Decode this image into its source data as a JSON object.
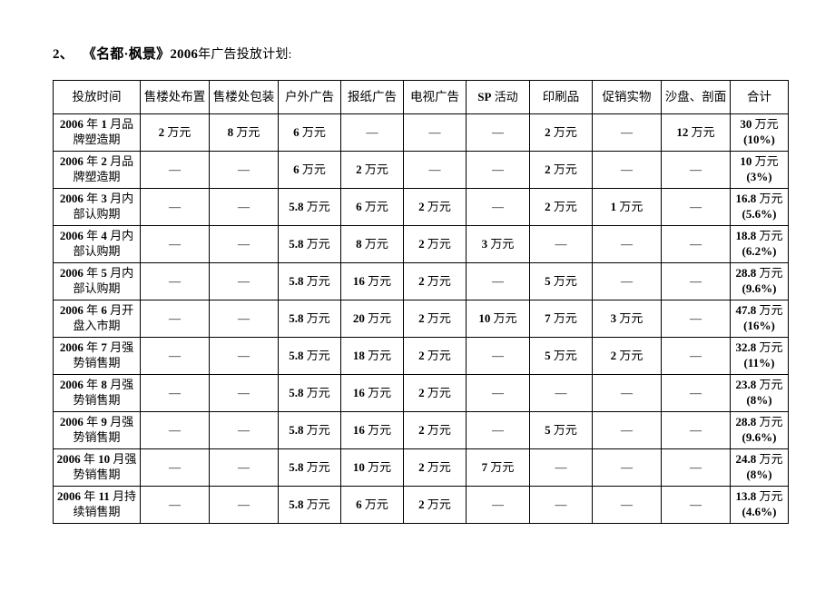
{
  "document": {
    "title_number": "2、",
    "title_main": "《名都·枫景》",
    "title_year": "2006",
    "title_tail": "年广告投放计划:"
  },
  "table": {
    "headers": [
      "投放时间",
      "售楼处布置",
      "售楼处包装",
      "户外广告",
      "报纸广告",
      "电视广告",
      "SP 活动",
      "印刷品",
      "促销实物",
      "沙盘、剖面",
      "合计"
    ],
    "sp_header": {
      "latin": "SP",
      "cjk": "活动"
    },
    "dash": "—",
    "rows": [
      {
        "period": "2006年1月品牌塑造期",
        "period_line1": "2006 年 1 月品",
        "period_line2": "牌塑造期",
        "cells": [
          "2 万元",
          "8 万元",
          "6 万元",
          "—",
          "—",
          "—",
          "2 万元",
          "—",
          "12 万元"
        ],
        "total": "30 万元",
        "percent": "(10%)"
      },
      {
        "period": "2006年2月品牌塑造期",
        "period_line1": "2006 年 2 月品",
        "period_line2": "牌塑造期",
        "cells": [
          "—",
          "—",
          "6 万元",
          "2 万元",
          "—",
          "—",
          "2 万元",
          "—",
          "—"
        ],
        "total": "10 万元",
        "percent": "(3%)"
      },
      {
        "period": "2006年3月内部认购期",
        "period_line1": "2006 年 3 月内",
        "period_line2": "部认购期",
        "cells": [
          "—",
          "—",
          "5.8 万元",
          "6 万元",
          "2 万元",
          "—",
          "2 万元",
          "1 万元",
          "—"
        ],
        "total": "16.8 万元",
        "percent": "(5.6%)"
      },
      {
        "period": "2006年4月内部认购期",
        "period_line1": "2006 年 4 月内",
        "period_line2": "部认购期",
        "cells": [
          "—",
          "—",
          "5.8 万元",
          "8 万元",
          "2 万元",
          "3 万元",
          "—",
          "—",
          "—"
        ],
        "total": "18.8 万元",
        "percent": "(6.2%)"
      },
      {
        "period": "2006年5月内部认购期",
        "period_line1": "2006 年 5 月内",
        "period_line2": "部认购期",
        "cells": [
          "—",
          "—",
          "5.8 万元",
          "16 万元",
          "2 万元",
          "—",
          "5 万元",
          "—",
          "—"
        ],
        "total": "28.8 万元",
        "percent": "(9.6%)"
      },
      {
        "period": "2006年6月开盘入市期",
        "period_line1": "2006 年 6 月开",
        "period_line2": "盘入市期",
        "cells": [
          "—",
          "—",
          "5.8 万元",
          "20 万元",
          "2 万元",
          "10 万元",
          "7 万元",
          "3 万元",
          "—"
        ],
        "total": "47.8 万元",
        "percent": "(16%)"
      },
      {
        "period": "2006年7月强势销售期",
        "period_line1": "2006 年 7 月强",
        "period_line2": "势销售期",
        "cells": [
          "—",
          "—",
          "5.8 万元",
          "18 万元",
          "2 万元",
          "—",
          "5 万元",
          "2 万元",
          "—"
        ],
        "total": "32.8 万元",
        "percent": "(11%)"
      },
      {
        "period": "2006年8月强势销售期",
        "period_line1": "2006 年 8 月强",
        "period_line2": "势销售期",
        "cells": [
          "—",
          "—",
          "5.8 万元",
          "16 万元",
          "2 万元",
          "—",
          "—",
          "—",
          "—"
        ],
        "total": "23.8 万元",
        "percent": "(8%)"
      },
      {
        "period": "2006年9月强势销售期",
        "period_line1": "2006 年 9 月强",
        "period_line2": "势销售期",
        "cells": [
          "—",
          "—",
          "5.8 万元",
          "16 万元",
          "2 万元",
          "—",
          "5 万元",
          "—",
          "—"
        ],
        "total": "28.8 万元",
        "percent": "(9.6%)"
      },
      {
        "period": "2006年10月强势销售期",
        "period_line1": "2006 年 10 月强",
        "period_line2": "势销售期",
        "cells": [
          "—",
          "—",
          "5.8 万元",
          "10 万元",
          "2 万元",
          "7 万元",
          "—",
          "—",
          "—"
        ],
        "total": "24.8 万元",
        "percent": "(8%)"
      },
      {
        "period": "2006年11月持续销售期",
        "period_line1": "2006 年 11 月持",
        "period_line2": "续销售期",
        "cells": [
          "—",
          "—",
          "5.8 万元",
          "6 万元",
          "2 万元",
          "—",
          "—",
          "—",
          "—"
        ],
        "total": "13.8 万元",
        "percent": "(4.6%)"
      }
    ]
  }
}
